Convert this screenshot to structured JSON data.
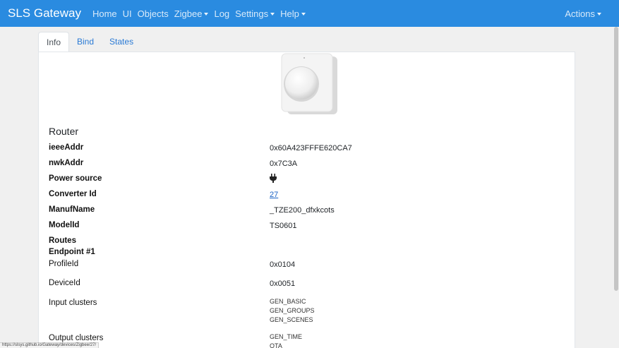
{
  "navbar": {
    "brand": "SLS Gateway",
    "items": [
      {
        "label": "Home",
        "dropdown": false
      },
      {
        "label": "UI",
        "dropdown": false
      },
      {
        "label": "Objects",
        "dropdown": false
      },
      {
        "label": "Zigbee",
        "dropdown": true
      },
      {
        "label": "Log",
        "dropdown": false
      },
      {
        "label": "Settings",
        "dropdown": true
      },
      {
        "label": "Help",
        "dropdown": true
      }
    ],
    "actions_label": "Actions",
    "bg_color": "#2a8be0"
  },
  "tabs": [
    {
      "label": "Info",
      "active": true
    },
    {
      "label": "Bind",
      "active": false
    },
    {
      "label": "States",
      "active": false
    }
  ],
  "device": {
    "type": "Router",
    "fields": {
      "ieee_label": "ieeeAddr",
      "ieee_value": "0x60A423FFFE620CA7",
      "nwk_label": "nwkAddr",
      "nwk_value": "0x7C3A",
      "power_label": "Power source",
      "power_icon": "plug-icon",
      "converter_label": "Converter Id",
      "converter_value": "27",
      "manuf_label": "ManufName",
      "manuf_value": "_TZE200_dfxkcots",
      "model_label": "ModelId",
      "model_value": "TS0601",
      "routes_label": "Routes"
    },
    "endpoint": {
      "title": "Endpoint #1",
      "profile_label": "ProfileId",
      "profile_value": "0x0104",
      "device_label": "DeviceId",
      "device_value": "0x0051",
      "input_label": "Input clusters",
      "input_clusters": [
        "GEN_BASIC",
        "GEN_GROUPS",
        "GEN_SCENES"
      ],
      "output_label": "Output clusters",
      "output_clusters": [
        "GEN_TIME",
        "OTA"
      ]
    }
  },
  "status_url": "https://slsys.github.io/Gateway/devices/Zigbee/27/"
}
